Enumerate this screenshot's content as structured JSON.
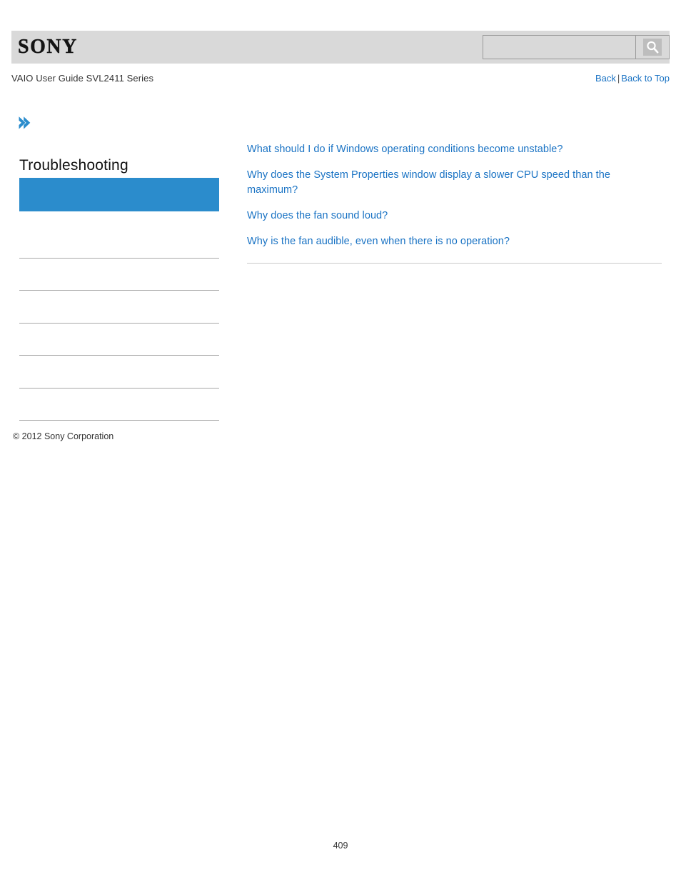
{
  "header": {
    "logo_text": "SONY",
    "search": {
      "value": "",
      "placeholder": "",
      "icon": "search-icon"
    }
  },
  "subheader": {
    "guide_title": "VAIO User Guide SVL2411 Series",
    "nav": {
      "back_label": "Back",
      "separator": "|",
      "back_to_top_label": "Back to Top"
    }
  },
  "sidebar": {
    "arrow_icon": "double-chevron-right-icon",
    "section_title": "Troubleshooting",
    "highlight_label": "",
    "rows": [
      "",
      "",
      "",
      "",
      "",
      ""
    ]
  },
  "main": {
    "topics": [
      "What should I do if Windows operating conditions become unstable?",
      "Why does the System Properties window display a slower CPU speed than the maximum?",
      "Why does the fan sound loud?",
      "Why is the fan audible, even when there is no operation?"
    ]
  },
  "footer": {
    "copyright": "© 2012 Sony Corporation",
    "page_number": "409"
  },
  "colors": {
    "header_bg": "#d9d9d9",
    "accent_blue": "#2b8ccc",
    "link_blue": "#1a73c4",
    "divider": "#a8a8a8",
    "content_divider": "#c9c9c9"
  }
}
